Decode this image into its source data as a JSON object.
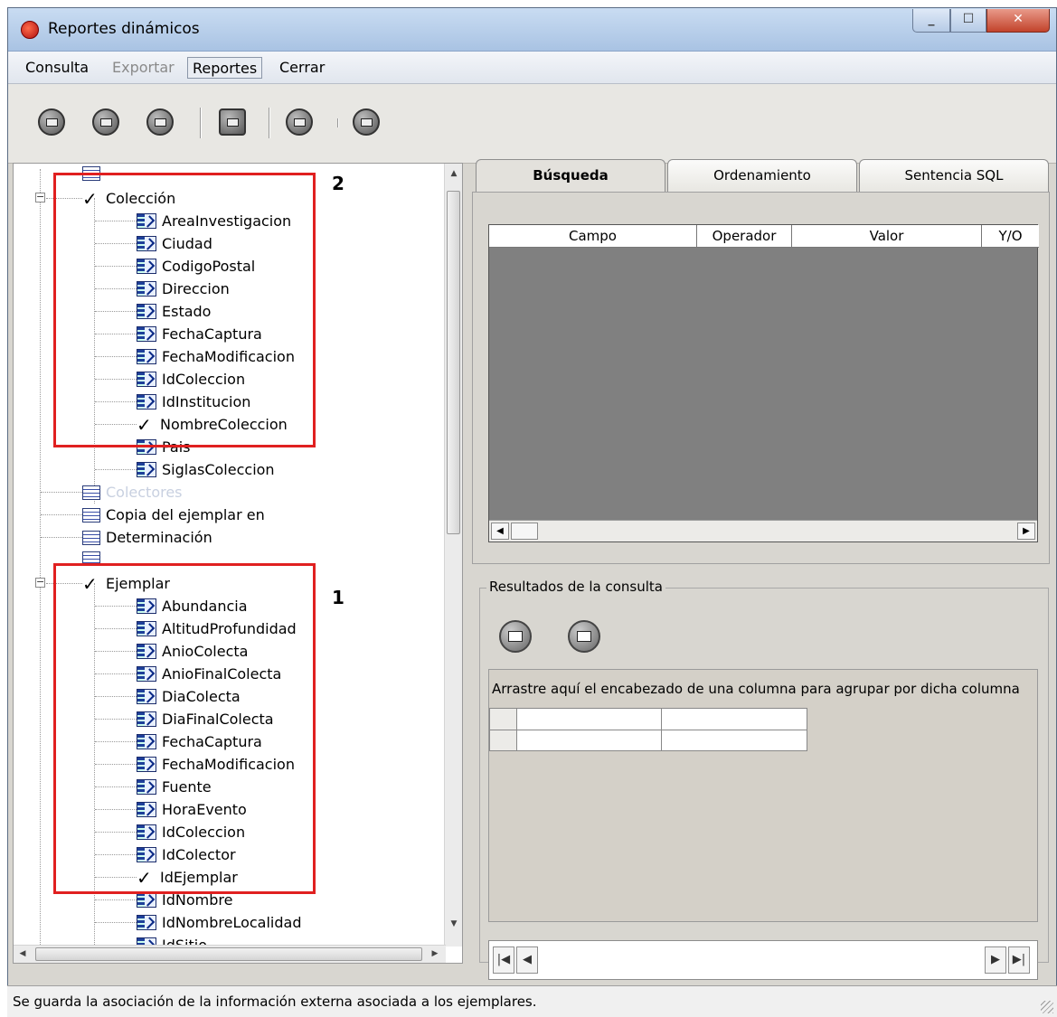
{
  "window": {
    "title": "Reportes dinámicos",
    "controls": [
      "minimize-icon",
      "maximize-icon",
      "close-icon"
    ]
  },
  "menu": {
    "items": [
      "Consulta",
      "Exportar",
      "Reportes",
      "Cerrar"
    ]
  },
  "toolbar": {
    "buttons": [
      "open-query-icon",
      "save-query-icon",
      "save-as-icon",
      "report-designer-icon",
      "run-query-icon",
      "exit-icon"
    ]
  },
  "tree": {
    "coleccion": {
      "label": "Colección",
      "fields": [
        "AreaInvestigacion",
        "Ciudad",
        "CodigoPostal",
        "Direccion",
        "Estado",
        "FechaCaptura",
        "FechaModificacion",
        "IdColeccion",
        "IdInstitucion",
        "NombreColeccion",
        "Pais",
        "SiglasColeccion"
      ]
    },
    "tables": [
      "Colectores",
      "Copia del ejemplar en",
      "Determinación"
    ],
    "ejemplar": {
      "label": "Ejemplar",
      "fields": [
        "Abundancia",
        "AltitudProfundidad",
        "AnioColecta",
        "AnioFinalColecta",
        "DiaColecta",
        "DiaFinalColecta",
        "FechaCaptura",
        "FechaModificacion",
        "Fuente",
        "HoraEvento",
        "IdColeccion",
        "IdColector",
        "IdEjemplar",
        "IdNombre",
        "IdNombreLocalidad",
        "IdSitio"
      ]
    },
    "annotations": [
      "2",
      "1"
    ]
  },
  "tabs": [
    "Búsqueda",
    "Ordenamiento",
    "Sentencia SQL"
  ],
  "search_grid": {
    "columns": [
      "Campo",
      "Operador",
      "Valor",
      "Y/O"
    ]
  },
  "results": {
    "label": "Resultados de la consulta",
    "buttons": [
      "preview-icon",
      "grid-view-icon"
    ],
    "group_hint": "Arrastre aquí el encabezado de una columna para agrupar por dicha columna"
  },
  "status": {
    "text": "Se guarda la asociación de la información externa asociada a los ejemplares."
  }
}
